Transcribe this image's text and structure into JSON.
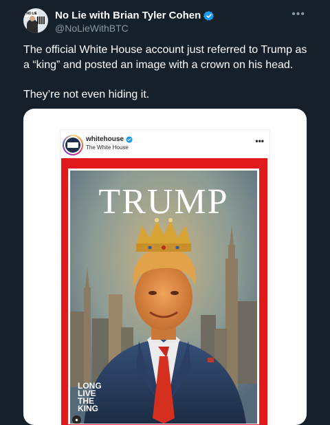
{
  "tweet": {
    "author": {
      "display_name": "No Lie with Brian Tyler Cohen",
      "handle": "@NoLieWithBTC",
      "verified": true,
      "avatar_badge": "NO LIE"
    },
    "more_icon": "more-horizontal-icon",
    "text": {
      "paragraph_1": "The official White House account just referred to Trump as a “king” and posted an image with a crown on his head.",
      "paragraph_2": "They’re not even hiding it."
    }
  },
  "embedded_post": {
    "account": "whitehouse",
    "subtitle": "The White House",
    "verified": true,
    "cover": {
      "title": "TRUMP",
      "slogan_lines": [
        "LONG",
        "LIVE",
        "THE",
        "KING"
      ],
      "border_color": "#e11b1b"
    }
  },
  "colors": {
    "background": "#15202b",
    "verified_blue": "#1d9bf0",
    "secondary_text": "#8b98a5"
  }
}
